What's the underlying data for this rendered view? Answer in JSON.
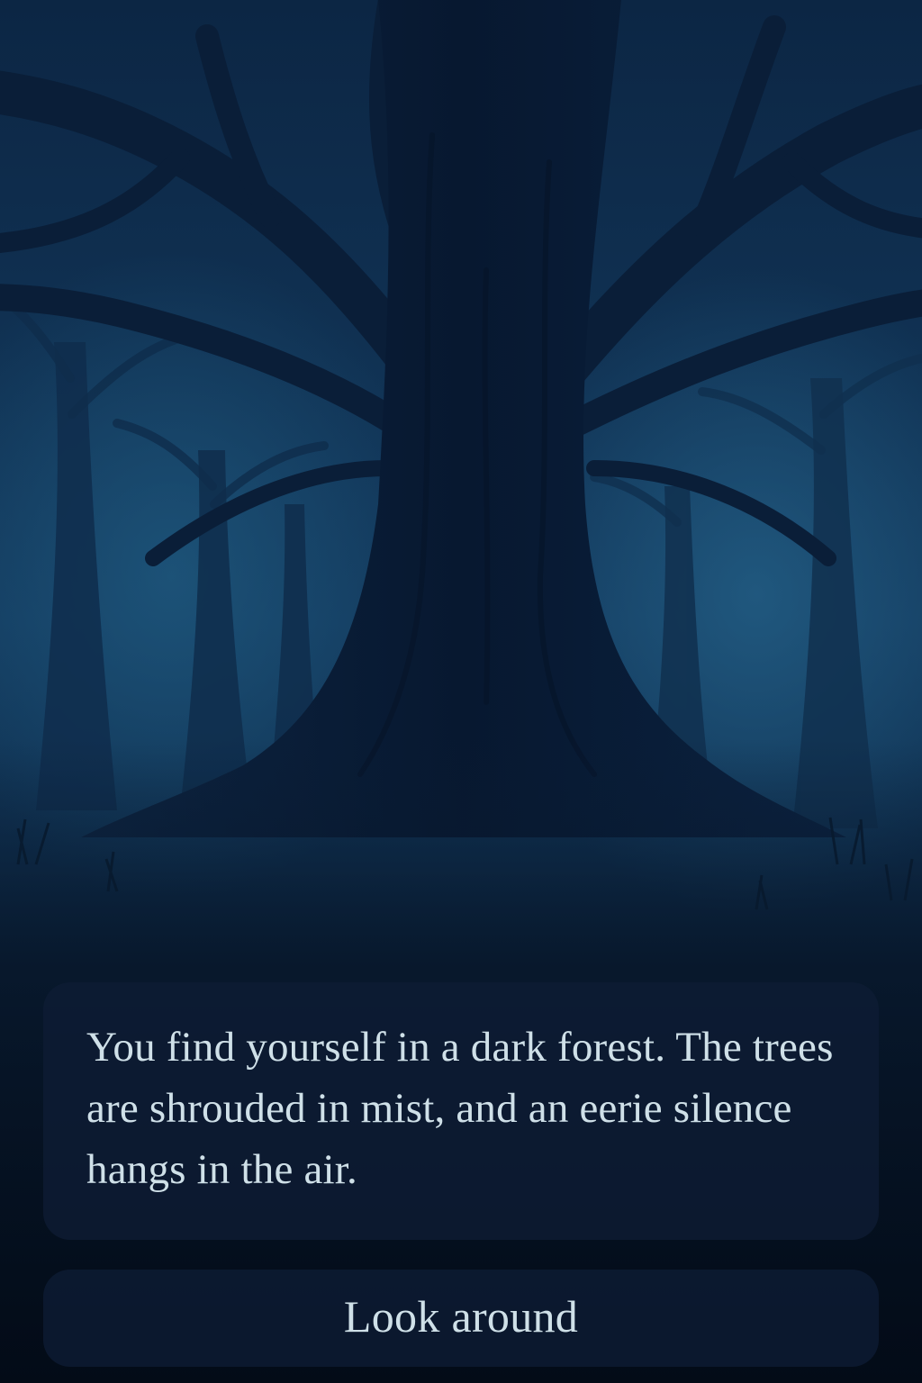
{
  "scene": {
    "description_icon": "dark-forest-illustration"
  },
  "narration": {
    "text": "You find yourself in a dark forest. The trees are shrouded in mist, and an eerie silence hangs in the air."
  },
  "choices": [
    {
      "label": "Look around"
    }
  ],
  "colors": {
    "background": "#04101f",
    "panel": "#0e1c34",
    "text": "#cfe0e8"
  }
}
